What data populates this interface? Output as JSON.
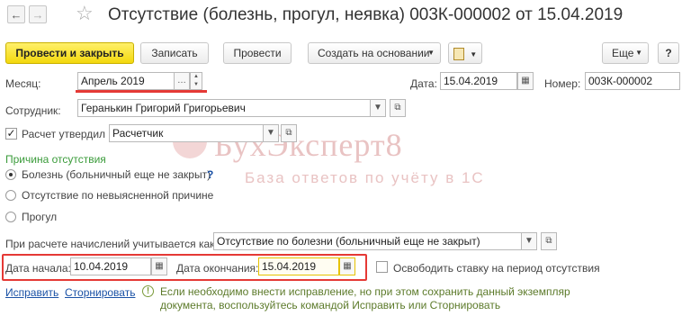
{
  "window": {
    "title": "Отсутствие (болезнь, прогул, неявка) 003К-000002 от 15.04.2019"
  },
  "nav": {
    "back_icon": "arrow-left-icon",
    "forward_icon": "arrow-right-icon",
    "favorite_icon": "star-icon"
  },
  "toolbar": {
    "post_close": "Провести и закрыть",
    "save": "Записать",
    "post": "Провести",
    "create_based": "Создать на основании",
    "more": "Еще",
    "help": "?"
  },
  "form": {
    "month_label": "Месяц:",
    "month_value": "Апрель 2019",
    "date_label": "Дата:",
    "date_value": "15.04.2019",
    "number_label": "Номер:",
    "number_value": "003К-000002",
    "employee_label": "Сотрудник:",
    "employee_value": "Геранькин Григорий Григорьевич",
    "approved_label": "Расчет утвердил",
    "approved_checked": true,
    "approved_value": "Расчетчик",
    "reason_title": "Причина отсутствия",
    "reasons": [
      {
        "label": "Болезнь (больничный еще не закрыт)",
        "selected": true,
        "help": "?"
      },
      {
        "label": "Отсутствие по невыясненной причине",
        "selected": false
      },
      {
        "label": "Прогул",
        "selected": false
      }
    ],
    "accrual_label": "При расчете начислений учитывается как:",
    "accrual_value": "Отсутствие по болезни (больничный еще не закрыт)",
    "start_label": "Дата начала:",
    "start_value": "10.04.2019",
    "end_label": "Дата окончания:",
    "end_value": "15.04.2019",
    "free_rate_label": "Освободить ставку на период отсутствия",
    "free_rate_checked": false
  },
  "footer": {
    "fix_link": "Исправить",
    "reverse_link": "Сторнировать",
    "hint": "Если необходимо внести исправление, но при этом сохранить данный экземпляр документа, воспользуйтесь командой Исправить или Сторнировать"
  },
  "watermark": {
    "brand": "БухЭксперт8",
    "tagline": "База ответов по учёту в 1С"
  },
  "colors": {
    "highlight": "#e53935",
    "primary_button": "#f3d80d",
    "link": "#1b52a6",
    "section_title": "#3a9b3a"
  }
}
